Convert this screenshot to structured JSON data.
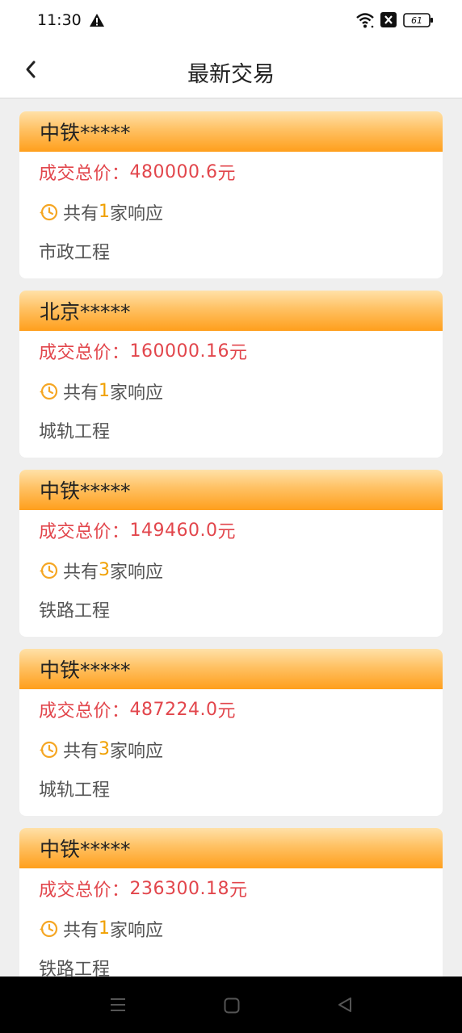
{
  "status_bar": {
    "time": "11:30",
    "battery": "61",
    "icons": [
      "warning-icon",
      "wifi-icon",
      "x-icon",
      "battery-icon"
    ]
  },
  "header": {
    "title": "最新交易",
    "back_icon": "chevron-left-icon"
  },
  "labels": {
    "price_prefix": "成交总价：",
    "price_suffix": "元",
    "response_prefix": "共有",
    "response_suffix": "家响应"
  },
  "items": [
    {
      "company": "中铁*****",
      "price": "480000.6",
      "responses": "1",
      "category": "市政工程"
    },
    {
      "company": "北京*****",
      "price": "160000.16",
      "responses": "1",
      "category": "城轨工程"
    },
    {
      "company": "中铁*****",
      "price": "149460.0",
      "responses": "3",
      "category": "铁路工程"
    },
    {
      "company": "中铁*****",
      "price": "487224.0",
      "responses": "3",
      "category": "城轨工程"
    },
    {
      "company": "中铁*****",
      "price": "236300.18",
      "responses": "1",
      "category": "铁路工程"
    }
  ],
  "colors": {
    "price": "#e2464c",
    "count": "#f0a000",
    "header_gradient_top": "#ffe1a8",
    "header_gradient_bottom": "#ff9f1c"
  },
  "nav_bar": {
    "icons": [
      "menu-icon",
      "home-icon",
      "back-icon"
    ]
  }
}
